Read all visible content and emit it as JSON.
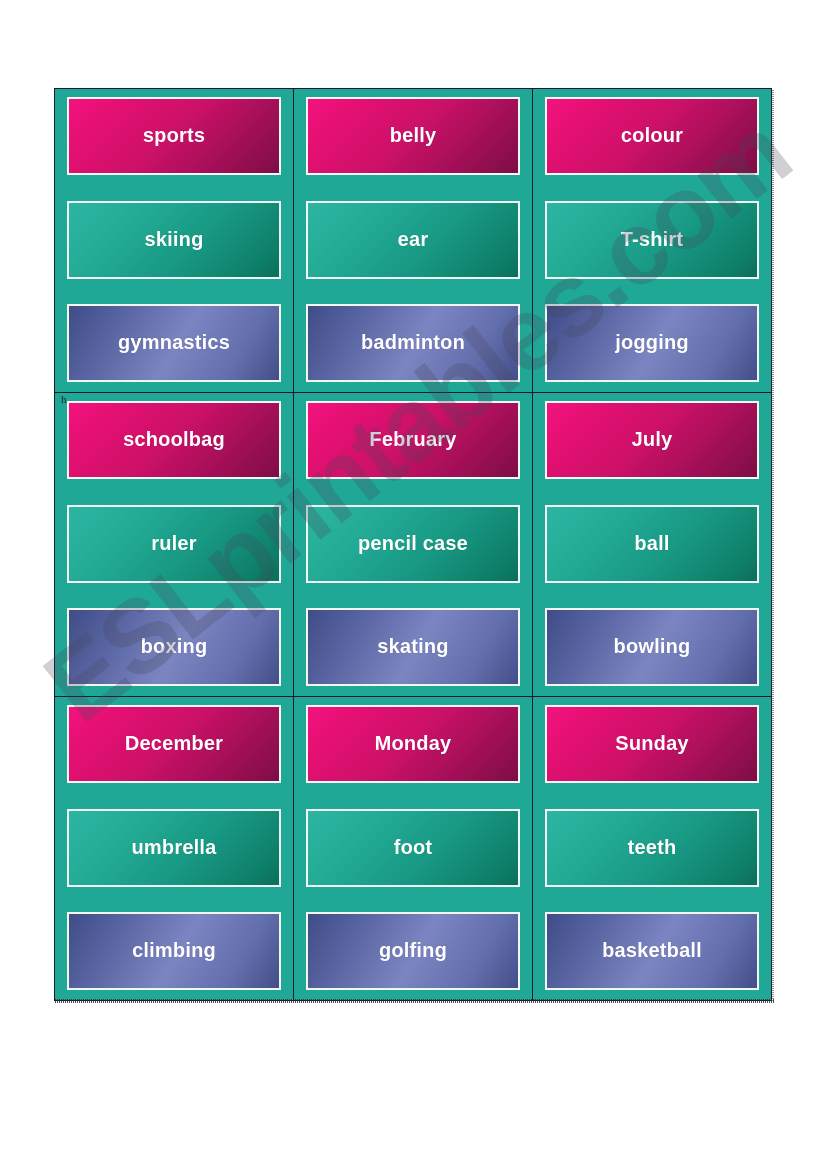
{
  "document": {
    "title": "ESL Flashcards Worksheet",
    "watermark": "ESLprintables.com",
    "stray_character": "h"
  },
  "colors": {
    "page_background": "#ffffff",
    "table_background": "#1fa895",
    "grid_line": "#1a1a2e",
    "card_border": "#f2f7f6",
    "card_text": "#ffffff",
    "pink_start": "#f4127e",
    "pink_end": "#7d0d46",
    "teal_start": "#2cb6a1",
    "teal_end": "#0a6f5b",
    "blue_start": "#3f4c86",
    "blue_mid": "#7b85c1",
    "blue_end": "#434f89",
    "watermark": "#46465a"
  },
  "grid": {
    "rows": 3,
    "columns": 3,
    "cards_per_cell": 3,
    "cells": [
      [
        {
          "cards": [
            {
              "label": "sports",
              "style": "pink"
            },
            {
              "label": "skiing",
              "style": "teal"
            },
            {
              "label": "gymnastics",
              "style": "blue"
            }
          ]
        },
        {
          "cards": [
            {
              "label": "belly",
              "style": "pink"
            },
            {
              "label": "ear",
              "style": "teal"
            },
            {
              "label": "badminton",
              "style": "blue"
            }
          ]
        },
        {
          "cards": [
            {
              "label": "colour",
              "style": "pink"
            },
            {
              "label": "T-shirt",
              "style": "teal"
            },
            {
              "label": "jogging",
              "style": "blue"
            }
          ]
        }
      ],
      [
        {
          "cards": [
            {
              "label": "schoolbag",
              "style": "pink"
            },
            {
              "label": "ruler",
              "style": "teal"
            },
            {
              "label": "boxing",
              "style": "blue"
            }
          ]
        },
        {
          "cards": [
            {
              "label": "February",
              "style": "pink"
            },
            {
              "label": "pencil case",
              "style": "teal"
            },
            {
              "label": "skating",
              "style": "blue"
            }
          ]
        },
        {
          "cards": [
            {
              "label": "July",
              "style": "pink"
            },
            {
              "label": "ball",
              "style": "teal"
            },
            {
              "label": "bowling",
              "style": "blue"
            }
          ]
        }
      ],
      [
        {
          "cards": [
            {
              "label": "December",
              "style": "pink"
            },
            {
              "label": "umbrella",
              "style": "teal"
            },
            {
              "label": "climbing",
              "style": "blue"
            }
          ]
        },
        {
          "cards": [
            {
              "label": "Monday",
              "style": "pink"
            },
            {
              "label": "foot",
              "style": "teal"
            },
            {
              "label": "golfing",
              "style": "blue"
            }
          ]
        },
        {
          "cards": [
            {
              "label": "Sunday",
              "style": "pink"
            },
            {
              "label": "teeth",
              "style": "teal"
            },
            {
              "label": "basketball",
              "style": "blue"
            }
          ]
        }
      ]
    ]
  }
}
